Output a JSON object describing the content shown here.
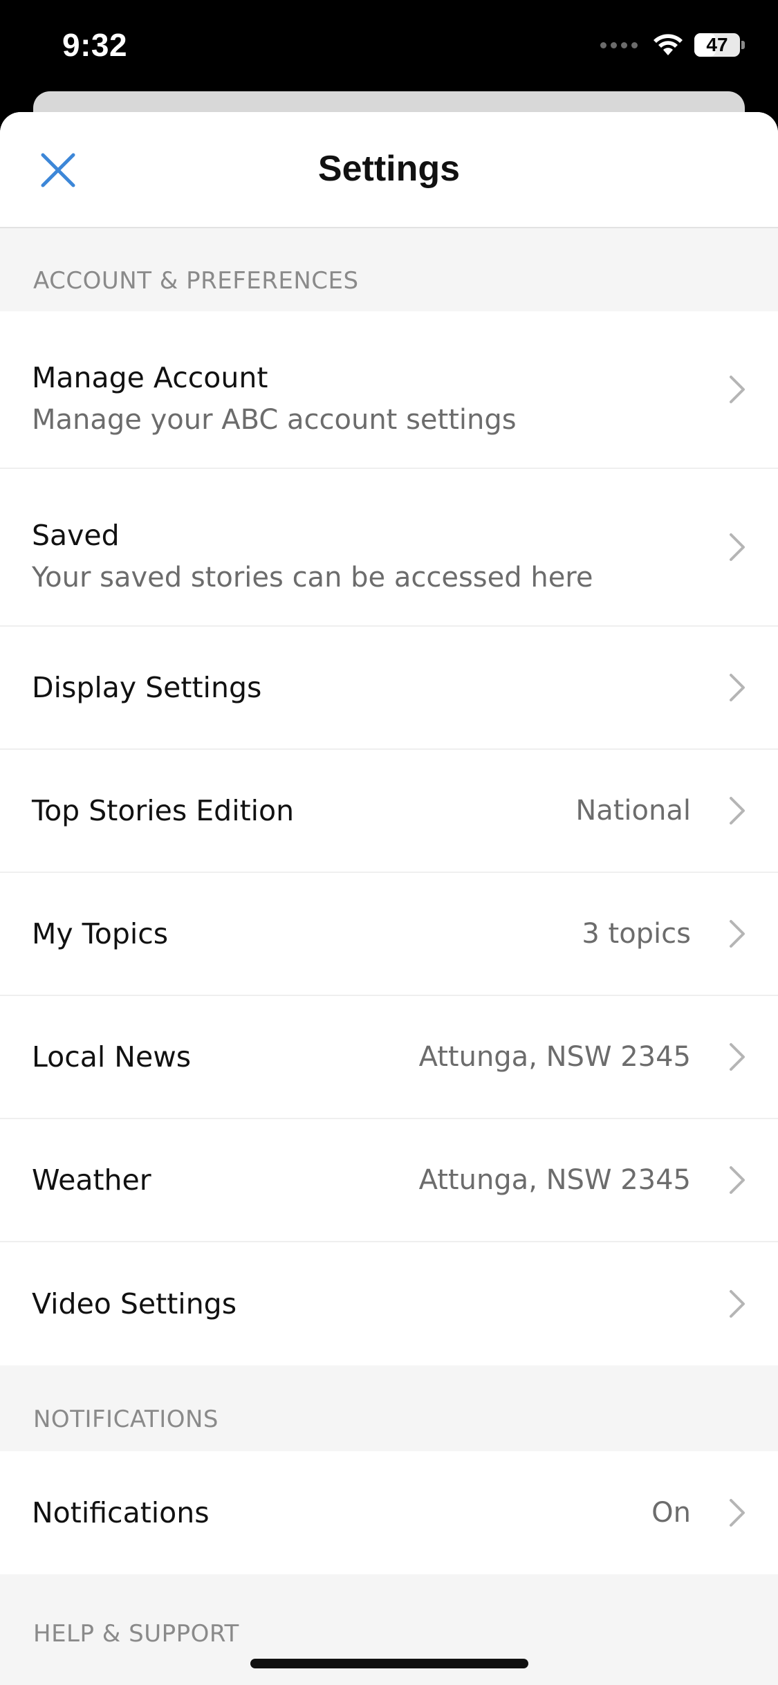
{
  "status_bar": {
    "time": "9:32",
    "battery_level": "47",
    "battery_fill_fraction": 0.47,
    "icons": [
      "signal-icon",
      "wifi-icon",
      "battery-icon"
    ]
  },
  "sheet": {
    "title": "Settings",
    "close_icon": "close-icon"
  },
  "colors": {
    "accent": "#3d87d8",
    "title_text": "#111111",
    "secondary_text": "#6c6c6c",
    "section_header_text": "#8a8a8a",
    "background": "#f5f5f5",
    "chevron": "#b5b5b5"
  },
  "sections": {
    "account": {
      "header": "ACCOUNT & PREFERENCES",
      "rows": [
        {
          "title": "Manage Account",
          "subtitle": "Manage your ABC account settings"
        },
        {
          "title": "Saved",
          "subtitle": "Your saved stories can be accessed here"
        },
        {
          "title": "Display Settings"
        },
        {
          "title": "Top Stories Edition",
          "value": "National"
        },
        {
          "title": "My Topics",
          "value": "3 topics"
        },
        {
          "title": "Local News",
          "value": "Attunga, NSW 2345"
        },
        {
          "title": "Weather",
          "value": "Attunga, NSW 2345"
        },
        {
          "title": "Video Settings"
        }
      ]
    },
    "notifications": {
      "header": "NOTIFICATIONS",
      "rows": [
        {
          "title": "Notifications",
          "value": "On"
        }
      ]
    },
    "help": {
      "header": "HELP & SUPPORT"
    }
  }
}
